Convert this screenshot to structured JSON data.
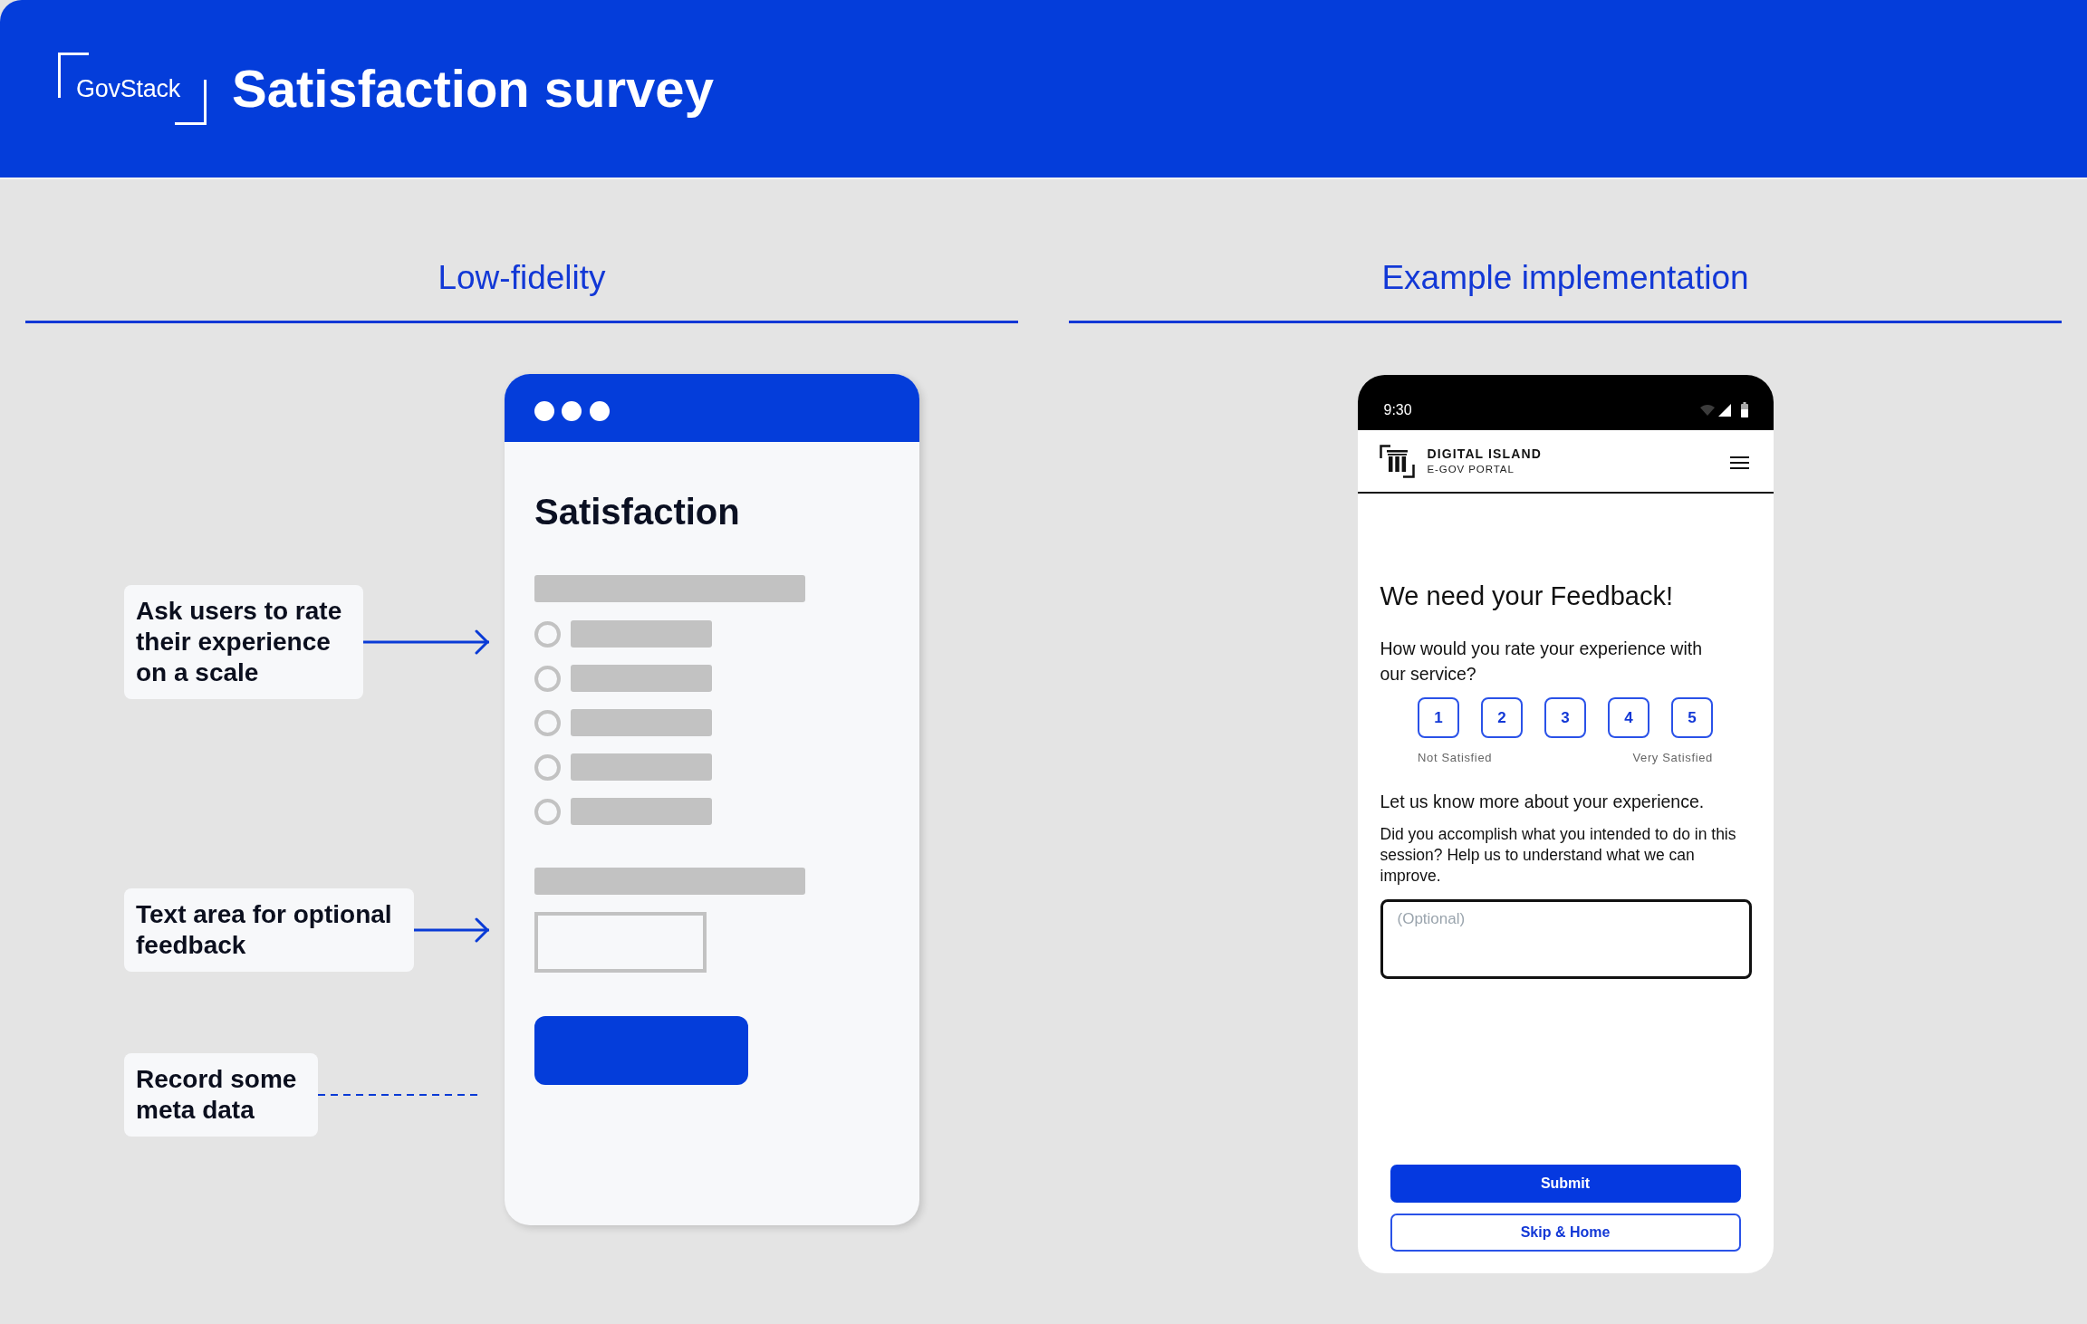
{
  "header": {
    "logo": "GovStack",
    "title": "Satisfaction survey"
  },
  "low_fidelity": {
    "heading": "Low-fidelity",
    "annotations": [
      {
        "text": "Ask users to rate their experience on a scale",
        "kind": "arrow"
      },
      {
        "text": "Text area for optional feedback",
        "kind": "arrow"
      },
      {
        "text": "Record some meta data",
        "kind": "dashed"
      }
    ],
    "wireframe": {
      "title": "Satisfaction",
      "options": [
        {
          "selected": false
        },
        {
          "selected": false
        },
        {
          "selected": false
        },
        {
          "selected": false
        },
        {
          "selected": false
        }
      ]
    }
  },
  "example": {
    "heading": "Example implementation",
    "status_bar": {
      "time": "9:30"
    },
    "portal": {
      "name": "DIGITAL ISLAND",
      "subtitle": "E-GOV PORTAL"
    },
    "title": "We need your Feedback!",
    "question": "How would you rate your experience with our service?",
    "rating": {
      "options": [
        {
          "label": "1",
          "selected": false
        },
        {
          "label": "2",
          "selected": false
        },
        {
          "label": "3",
          "selected": false
        },
        {
          "label": "4",
          "selected": false
        },
        {
          "label": "5",
          "selected": false
        }
      ],
      "low_label": "Not Satisfied",
      "high_label": "Very Satisfied"
    },
    "more_heading": "Let us know more about your experience.",
    "more_text": "Did you accomplish what you intended to do in this session? Help us to understand what we can improve.",
    "feedback": {
      "placeholder": "(Optional)"
    },
    "buttons": [
      {
        "label": "Submit",
        "kind": "primary"
      },
      {
        "label": "Skip & Home",
        "kind": "secondary"
      }
    ]
  }
}
